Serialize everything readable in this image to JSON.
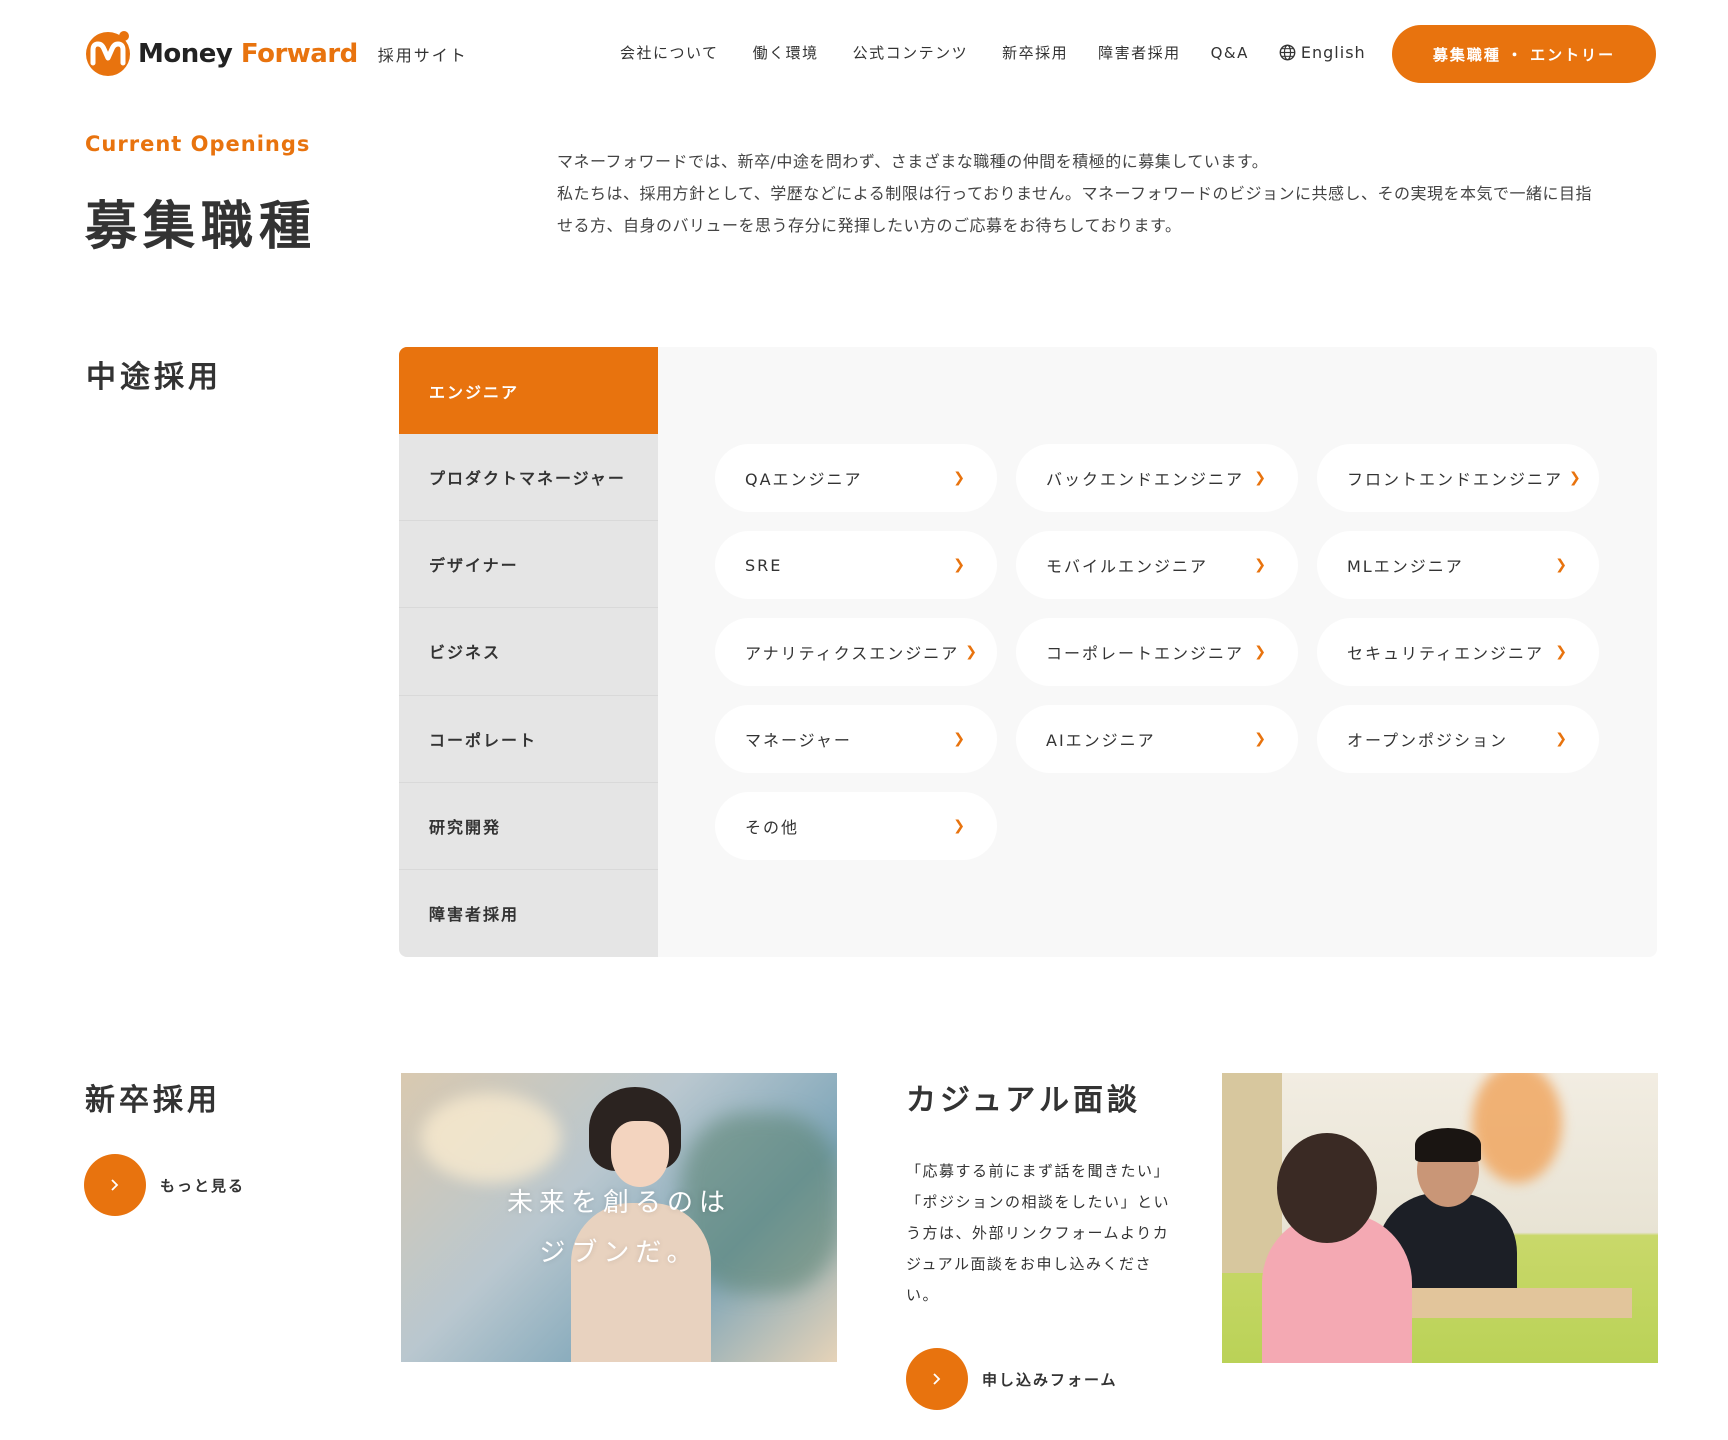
{
  "header": {
    "logo_money": "Money",
    "logo_forward": "Forward",
    "logo_sub": "採用サイト",
    "nav": [
      "会社について",
      "働く環境",
      "公式コンテンツ",
      "新卒採用",
      "障害者採用",
      "Q&A"
    ],
    "lang": "English",
    "entry_button": "募集職種 ・ エントリー"
  },
  "intro": {
    "eyebrow": "Current Openings",
    "title": "募集職種",
    "line1": "マネーフォワードでは、新卒/中途を問わず、さまざまな職種の仲間を積極的に募集しています。",
    "line2": "私たちは、採用方針として、学歴などによる制限は行っておりません。マネーフォワードのビジョンに共感し、その実現を本気で一緒に目指",
    "line3": "せる方、自身のバリューを思う存分に発揮したい方のご応募をお待ちしております。"
  },
  "mid_career": {
    "title": "中途採用",
    "categories": [
      "エンジニア",
      "プロダクトマネージャー",
      "デザイナー",
      "ビジネス",
      "コーポレート",
      "研究開発",
      "障害者採用"
    ],
    "active_category": "エンジニア",
    "jobs": [
      "QAエンジニア",
      "バックエンドエンジニア",
      "フロントエンドエンジニア",
      "SRE",
      "モバイルエンジニア",
      "MLエンジニア",
      "アナリティクスエンジニア",
      "コーポレートエンジニア",
      "セキュリティエンジニア",
      "マネージャー",
      "AIエンジニア",
      "オープンポジション",
      "その他"
    ]
  },
  "new_grad": {
    "title": "新卒採用",
    "more_label": "もっと見る",
    "tagline_1": "未来を創るのは",
    "tagline_2": "ジブンだ。"
  },
  "casual": {
    "title": "カジュアル面談",
    "text": "「応募する前にまず話を聞きたい」「ポジションの相談をしたい」という方は、外部リンクフォームよりカジュアル面談をお申し込みください。",
    "form_label": "申し込みフォーム"
  },
  "colors": {
    "accent": "#e8730e",
    "text": "#333333",
    "panel_bg": "#f8f8f8",
    "sidebar_bg": "#e5e5e5"
  }
}
